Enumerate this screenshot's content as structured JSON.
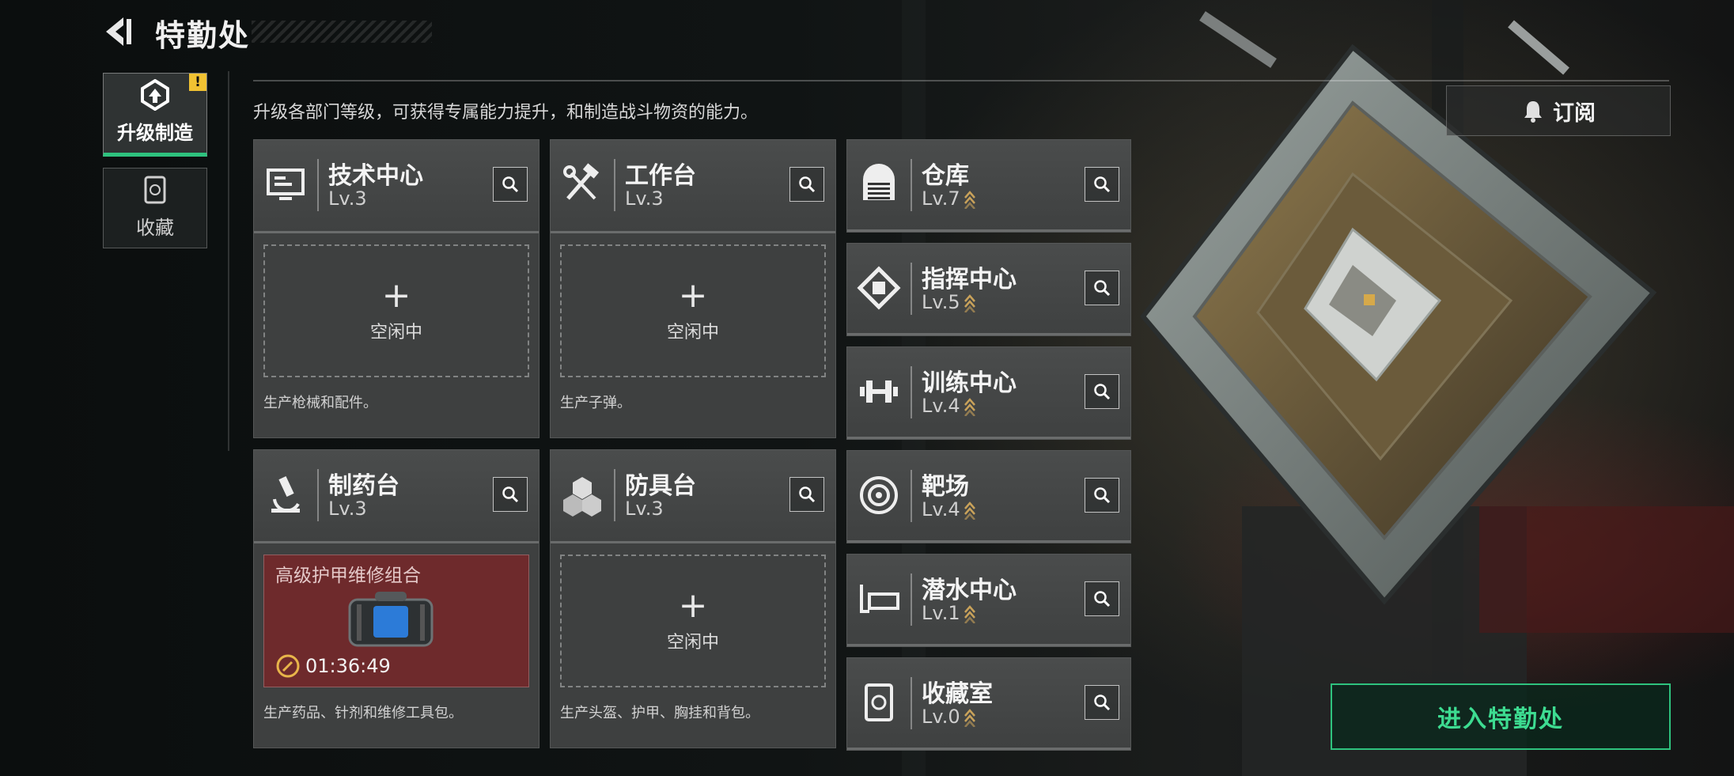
{
  "header": {
    "title": "特勤处"
  },
  "tabs": [
    {
      "label": "升级制造",
      "active": true,
      "badge": "!"
    },
    {
      "label": "收藏",
      "active": false
    }
  ],
  "description": "升级各部门等级，可获得专属能力提升，和制造战斗物资的能力。",
  "subscribe_label": "订阅",
  "big_cards": [
    {
      "name": "技术中心",
      "level": "Lv.3",
      "icon": "monitor-icon",
      "slot_state": "空闲中",
      "note": "生产枪械和配件。"
    },
    {
      "name": "工作台",
      "level": "Lv.3",
      "icon": "tools-icon",
      "slot_state": "空闲中",
      "note": "生产子弹。"
    },
    {
      "name": "制药台",
      "level": "Lv.3",
      "icon": "microscope-icon",
      "crafting": {
        "item": "高级护甲维修组合",
        "timer": "01:36:49"
      },
      "note": "生产药品、针剂和维修工具包。"
    },
    {
      "name": "防具台",
      "level": "Lv.3",
      "icon": "armor-blocks-icon",
      "slot_state": "空闲中",
      "note": "生产头盔、护甲、胸挂和背包。"
    }
  ],
  "small_cards": [
    {
      "name": "仓库",
      "level": "Lv.7",
      "icon": "warehouse-icon",
      "upgradable": true
    },
    {
      "name": "指挥中心",
      "level": "Lv.5",
      "icon": "command-chip-icon",
      "upgradable": true
    },
    {
      "name": "训练中心",
      "level": "Lv.4",
      "icon": "dumbbell-icon",
      "upgradable": true
    },
    {
      "name": "靶场",
      "level": "Lv.4",
      "icon": "target-icon",
      "upgradable": true
    },
    {
      "name": "潜水中心",
      "level": "Lv.1",
      "icon": "diving-mask-icon",
      "upgradable": true
    },
    {
      "name": "收藏室",
      "level": "Lv.0",
      "icon": "collection-icon",
      "upgradable": true
    }
  ],
  "enter_button": "进入特勤处",
  "colors": {
    "accent_green": "#2ec27e",
    "badge_yellow": "#f1c232",
    "upgrade_gold": "#c9a25a",
    "craft_red": "#6e2a2c"
  }
}
